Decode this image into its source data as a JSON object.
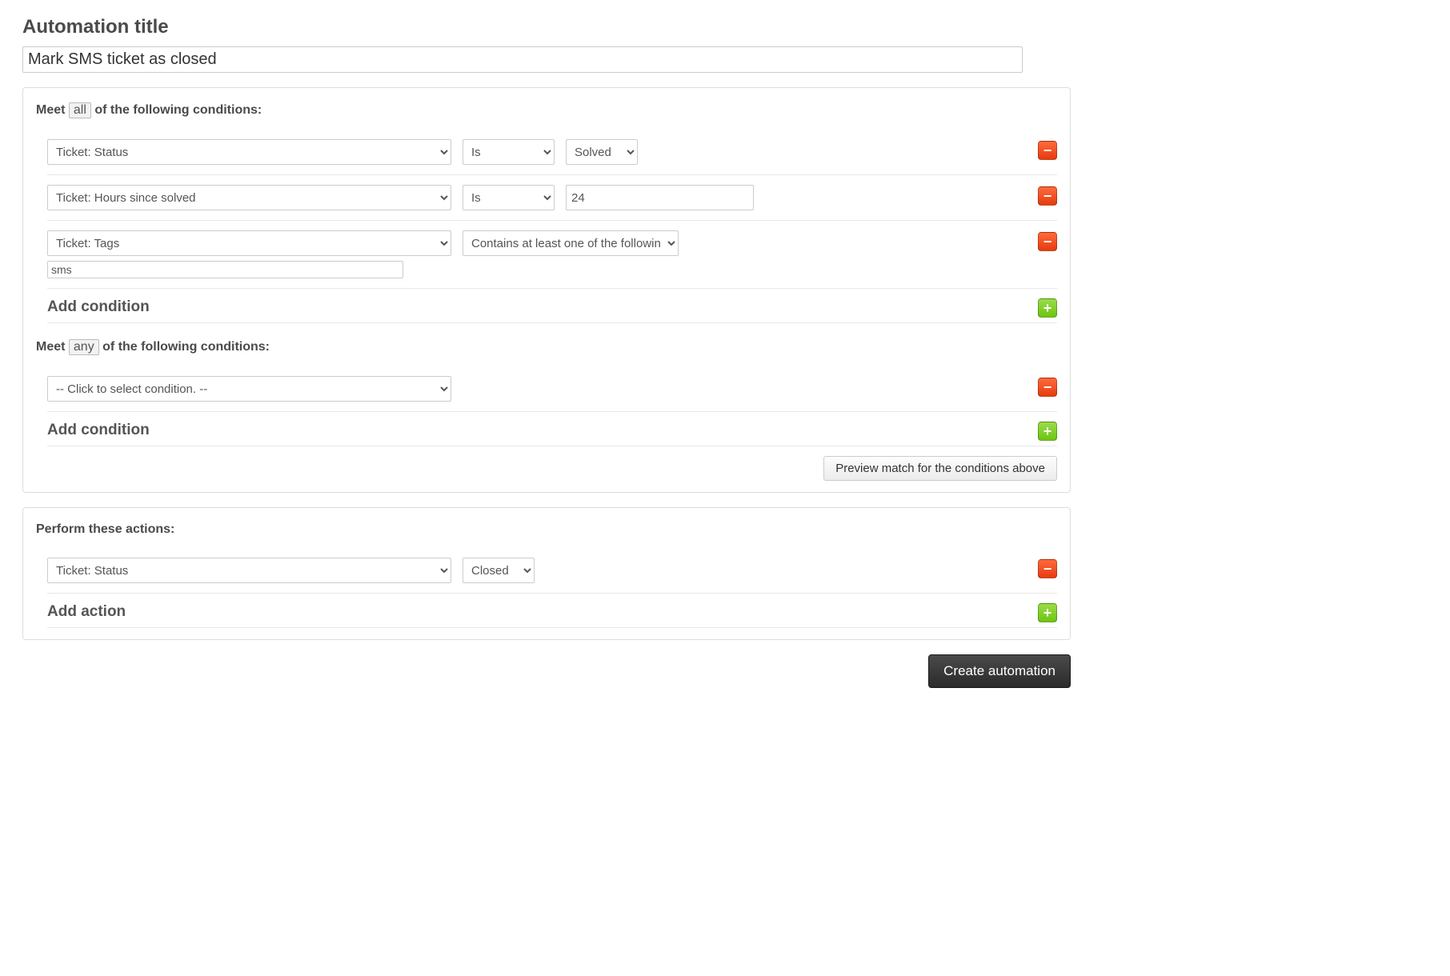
{
  "title": {
    "heading": "Automation title",
    "value": "Mark SMS ticket as closed"
  },
  "conditions_all": {
    "prefix": "Meet ",
    "chip": "all",
    "suffix": " of the following conditions:",
    "rows": [
      {
        "field": "Ticket: Status",
        "op": "Is",
        "value_select": "Solved"
      },
      {
        "field": "Ticket: Hours since solved",
        "op": "Is",
        "value_text": "24"
      },
      {
        "field": "Ticket: Tags",
        "op": "Contains at least one of the following",
        "tags_value": "sms"
      }
    ],
    "add_label": "Add condition"
  },
  "conditions_any": {
    "prefix": "Meet ",
    "chip": "any",
    "suffix": " of the following conditions:",
    "rows": [
      {
        "field": "-- Click to select condition. --"
      }
    ],
    "add_label": "Add condition"
  },
  "preview_label": "Preview match for the conditions above",
  "actions": {
    "heading": "Perform these actions:",
    "rows": [
      {
        "field": "Ticket: Status",
        "value_select": "Closed"
      }
    ],
    "add_label": "Add action"
  },
  "create_label": "Create automation"
}
